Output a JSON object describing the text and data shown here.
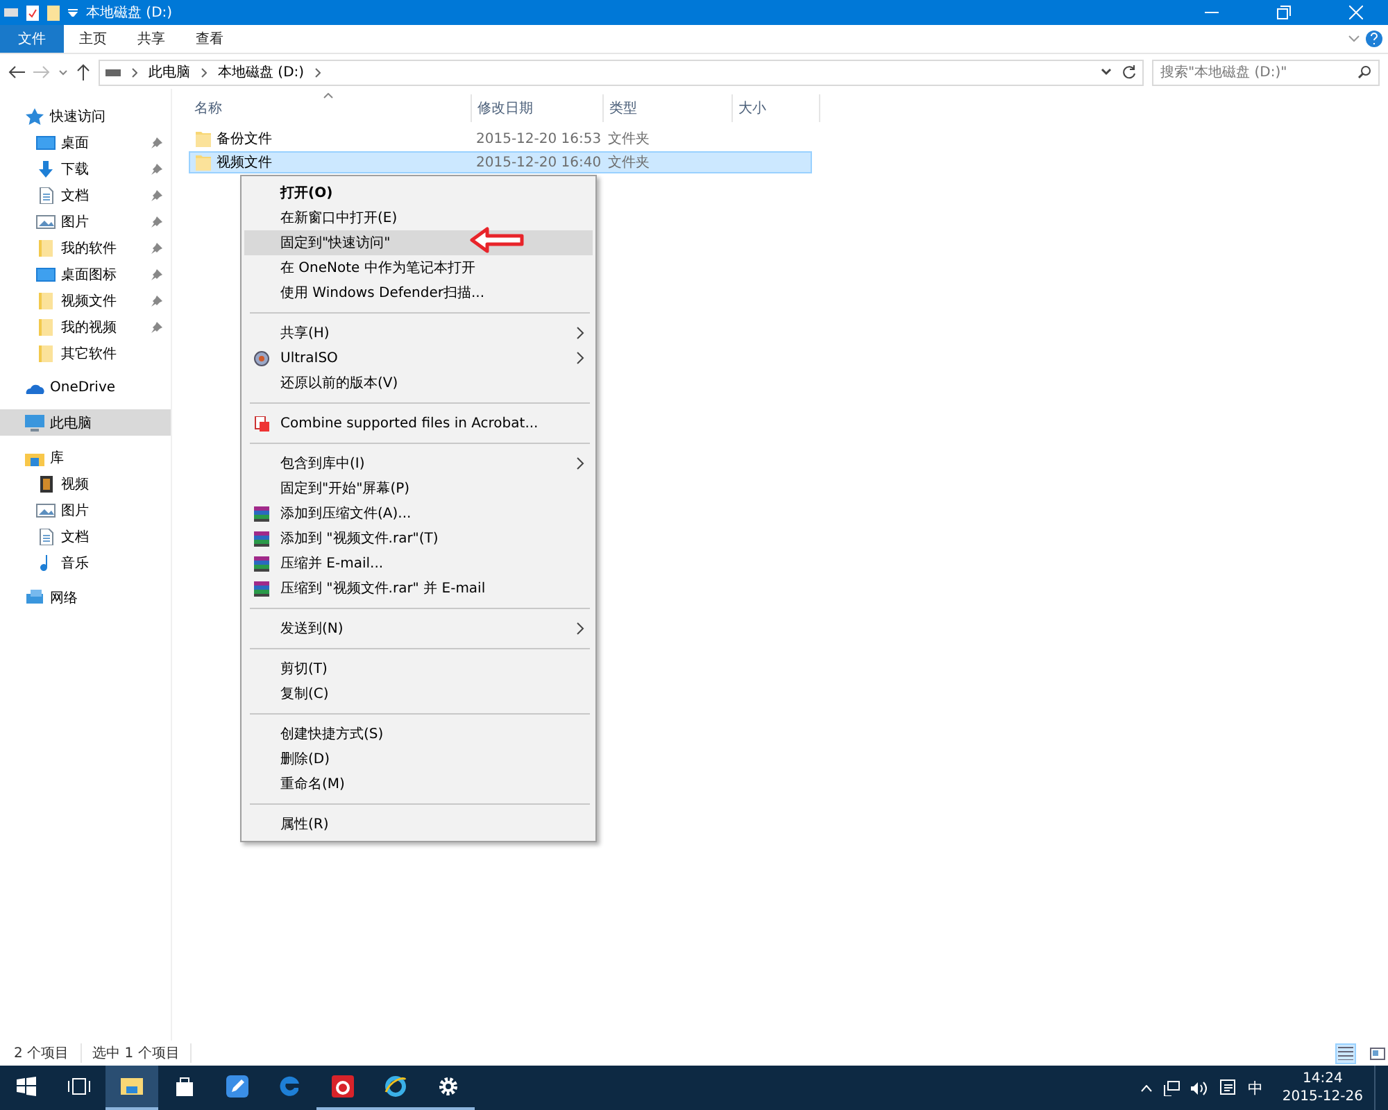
{
  "window": {
    "title": "本地磁盘 (D:)"
  },
  "ribbon_tabs": [
    {
      "label": "文件",
      "kind": "file"
    },
    {
      "label": "主页",
      "kind": "tab"
    },
    {
      "label": "共享",
      "kind": "tab"
    },
    {
      "label": "查看",
      "kind": "tab"
    }
  ],
  "address": {
    "crumbs": [
      "此电脑",
      "本地磁盘 (D:)"
    ]
  },
  "search": {
    "placeholder": "搜索\"本地磁盘 (D:)\""
  },
  "sidebar": [
    {
      "label": "快速访问",
      "kind": "star",
      "selected": false,
      "children": [
        {
          "label": "桌面",
          "kind": "desktop",
          "pinned": true
        },
        {
          "label": "下载",
          "kind": "download",
          "pinned": true
        },
        {
          "label": "文档",
          "kind": "document",
          "pinned": true
        },
        {
          "label": "图片",
          "kind": "picture",
          "pinned": true
        },
        {
          "label": "我的软件",
          "kind": "folder",
          "pinned": true
        },
        {
          "label": "桌面图标",
          "kind": "desktop",
          "pinned": true
        },
        {
          "label": "视频文件",
          "kind": "folder",
          "pinned": true
        },
        {
          "label": "我的视频",
          "kind": "folder",
          "pinned": true
        },
        {
          "label": "其它软件",
          "kind": "folder",
          "pinned": false
        }
      ]
    },
    {
      "label": "OneDrive",
      "kind": "cloud",
      "selected": false
    },
    {
      "label": "此电脑",
      "kind": "pc",
      "selected": true
    },
    {
      "label": "库",
      "kind": "library",
      "selected": false,
      "children": [
        {
          "label": "视频",
          "kind": "video",
          "pinned": false
        },
        {
          "label": "图片",
          "kind": "picture",
          "pinned": false
        },
        {
          "label": "文档",
          "kind": "document",
          "pinned": false
        },
        {
          "label": "音乐",
          "kind": "music",
          "pinned": false
        }
      ]
    },
    {
      "label": "网络",
      "kind": "network",
      "selected": false
    }
  ],
  "table": {
    "columns": [
      "名称",
      "修改日期",
      "类型",
      "大小"
    ],
    "rows": [
      {
        "name": "备份文件",
        "date": "2015-12-20 16:53",
        "type": "文件夹",
        "selected": false
      },
      {
        "name": "视频文件",
        "date": "2015-12-20 16:40",
        "type": "文件夹",
        "selected": true
      }
    ]
  },
  "context_menu": [
    {
      "kind": "item",
      "label": "打开(O)",
      "default": true,
      "selected": false,
      "submenu": false
    },
    {
      "kind": "item",
      "label": "在新窗口中打开(E)",
      "default": false,
      "selected": false,
      "submenu": false
    },
    {
      "kind": "item",
      "label": "固定到\"快速访问\"",
      "default": false,
      "selected": true,
      "submenu": false
    },
    {
      "kind": "item",
      "label": "在 OneNote 中作为笔记本打开",
      "default": false,
      "selected": false,
      "submenu": false
    },
    {
      "kind": "item",
      "label": "使用 Windows Defender扫描...",
      "default": false,
      "selected": false,
      "submenu": false
    },
    {
      "kind": "separator"
    },
    {
      "kind": "item",
      "label": "共享(H)",
      "default": false,
      "selected": false,
      "submenu": true
    },
    {
      "kind": "disc",
      "label": "UltraISO",
      "default": false,
      "selected": false,
      "submenu": true
    },
    {
      "kind": "item",
      "label": "还原以前的版本(V)",
      "default": false,
      "selected": false,
      "submenu": false
    },
    {
      "kind": "separator"
    },
    {
      "kind": "pdf",
      "label": "Combine supported files in Acrobat...",
      "default": false,
      "selected": false,
      "submenu": false
    },
    {
      "kind": "separator"
    },
    {
      "kind": "item",
      "label": "包含到库中(I)",
      "default": false,
      "selected": false,
      "submenu": true
    },
    {
      "kind": "item",
      "label": "固定到\"开始\"屏幕(P)",
      "default": false,
      "selected": false,
      "submenu": false
    },
    {
      "kind": "archive",
      "label": "添加到压缩文件(A)...",
      "default": false,
      "selected": false,
      "submenu": false
    },
    {
      "kind": "archive",
      "label": "添加到 \"视频文件.rar\"(T)",
      "default": false,
      "selected": false,
      "submenu": false
    },
    {
      "kind": "archive",
      "label": "压缩并 E-mail...",
      "default": false,
      "selected": false,
      "submenu": false
    },
    {
      "kind": "archive",
      "label": "压缩到 \"视频文件.rar\" 并 E-mail",
      "default": false,
      "selected": false,
      "submenu": false
    },
    {
      "kind": "separator"
    },
    {
      "kind": "item",
      "label": "发送到(N)",
      "default": false,
      "selected": false,
      "submenu": true
    },
    {
      "kind": "separator"
    },
    {
      "kind": "item",
      "label": "剪切(T)",
      "default": false,
      "selected": false,
      "submenu": false
    },
    {
      "kind": "item",
      "label": "复制(C)",
      "default": false,
      "selected": false,
      "submenu": false
    },
    {
      "kind": "separator"
    },
    {
      "kind": "item",
      "label": "创建快捷方式(S)",
      "default": false,
      "selected": false,
      "submenu": false
    },
    {
      "kind": "item",
      "label": "删除(D)",
      "default": false,
      "selected": false,
      "submenu": false
    },
    {
      "kind": "item",
      "label": "重命名(M)",
      "default": false,
      "selected": false,
      "submenu": false
    },
    {
      "kind": "separator"
    },
    {
      "kind": "item",
      "label": "属性(R)",
      "default": false,
      "selected": false,
      "submenu": false
    }
  ],
  "status_bar": {
    "items": [
      "2 个项目",
      "选中 1 个项目"
    ],
    "views": [
      {
        "kind": "details",
        "selected": true
      },
      {
        "kind": "tiles",
        "selected": false
      }
    ]
  },
  "taskbar": {
    "apps": [
      {
        "kind": "explorer",
        "running": true,
        "active": true
      },
      {
        "kind": "store",
        "running": false,
        "active": false
      },
      {
        "kind": "note",
        "running": false,
        "active": false
      },
      {
        "kind": "edge",
        "running": false,
        "active": false
      },
      {
        "kind": "music",
        "running": true,
        "active": false
      },
      {
        "kind": "ie",
        "running": true,
        "active": false
      },
      {
        "kind": "settings",
        "running": true,
        "active": false
      }
    ],
    "ime": "中",
    "time": "14:24",
    "date": "2015-12-26"
  }
}
